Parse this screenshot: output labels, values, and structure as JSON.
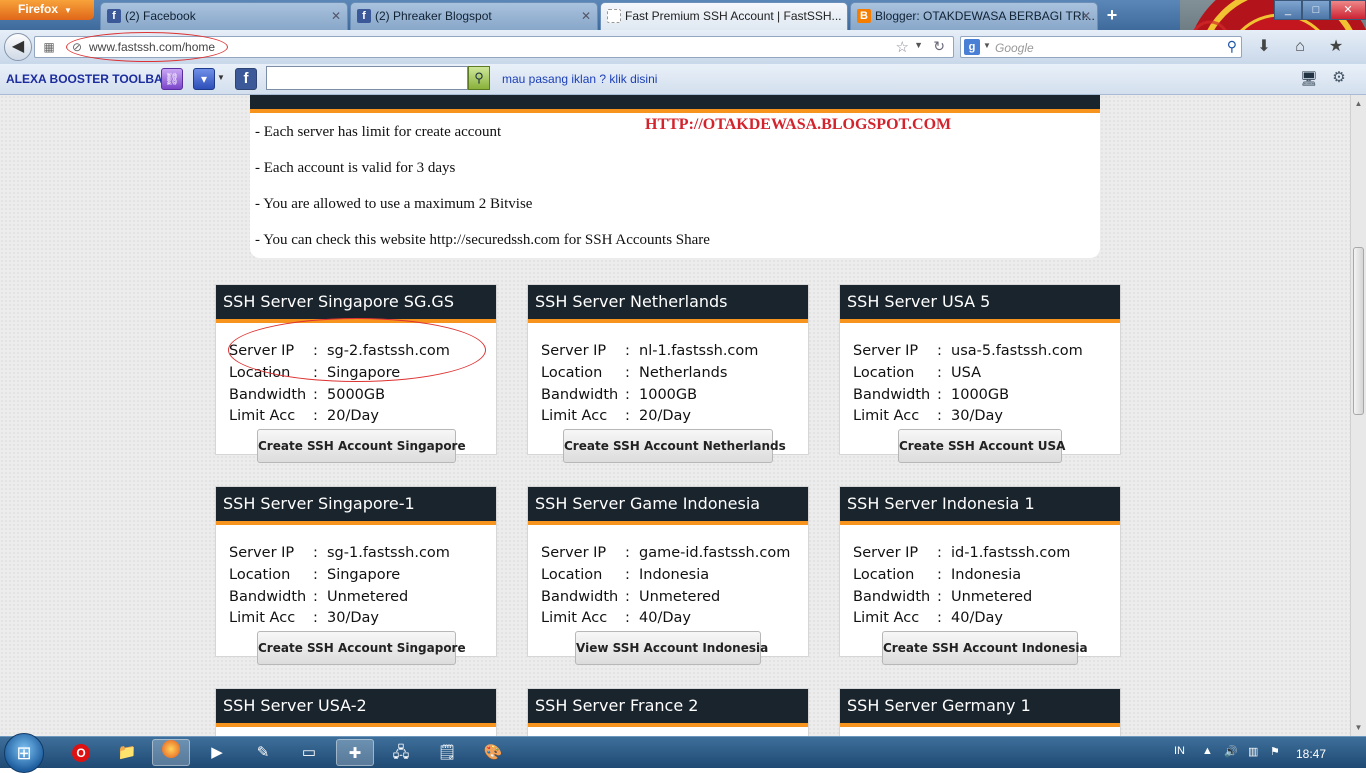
{
  "browser": {
    "menu_label": "Firefox",
    "tabs": [
      {
        "label": "(2) Facebook",
        "icon": "facebook-icon",
        "color": "#3b5998",
        "glyph": "f"
      },
      {
        "label": "(2) Phreaker Blogspot",
        "icon": "facebook-icon",
        "color": "#3b5998",
        "glyph": "f"
      },
      {
        "label": "Fast Premium SSH Account | FastSSH...",
        "icon": "page-icon",
        "color": "#cccccc",
        "glyph": ""
      },
      {
        "label": "Blogger: OTAKDEWASA BERBAGI TRI...",
        "icon": "blogger-icon",
        "color": "#f57d00",
        "glyph": "B"
      }
    ],
    "new_tab": "+",
    "url": "www.fastssh.com/home",
    "search_placeholder": "Google",
    "window_controls": [
      "_",
      "□",
      "✕"
    ]
  },
  "toolbar": {
    "title": "ALEXA BOOSTER TOOLBAR",
    "link_text": "mau pasang iklan ? klik disini"
  },
  "notice": {
    "lines": [
      "- Each server has limit for create account",
      "- Each account is valid for 3 days",
      "- You are allowed to use a maximum 2 Bitvise",
      "- You can check this website http://securedssh.com for SSH Accounts Share"
    ],
    "watermark": "HTTP://OTAKDEWASA.BLOGSPOT.COM"
  },
  "labels": {
    "server_ip": "Server IP",
    "location": "Location",
    "bandwidth": "Bandwidth",
    "limit": "Limit Acc",
    "sep": ":"
  },
  "servers": [
    {
      "title": "SSH Server Singapore SG.GS",
      "ip": "sg-2.fastssh.com",
      "location": "Singapore",
      "bandwidth": "5000GB",
      "limit": "20/Day",
      "button": "Create SSH Account Singapore"
    },
    {
      "title": "SSH Server Netherlands",
      "ip": "nl-1.fastssh.com",
      "location": "Netherlands",
      "bandwidth": "1000GB",
      "limit": "20/Day",
      "button": "Create SSH Account Netherlands"
    },
    {
      "title": "SSH Server USA 5",
      "ip": "usa-5.fastssh.com",
      "location": "USA",
      "bandwidth": "1000GB",
      "limit": "30/Day",
      "button": "Create SSH Account USA"
    },
    {
      "title": "SSH Server Singapore-1",
      "ip": "sg-1.fastssh.com",
      "location": "Singapore",
      "bandwidth": "Unmetered",
      "limit": "30/Day",
      "button": "Create SSH Account Singapore"
    },
    {
      "title": "SSH Server Game Indonesia",
      "ip": "game-id.fastssh.com",
      "location": "Indonesia",
      "bandwidth": "Unmetered",
      "limit": "40/Day",
      "button": "View SSH Account Indonesia"
    },
    {
      "title": "SSH Server Indonesia 1",
      "ip": "id-1.fastssh.com",
      "location": "Indonesia",
      "bandwidth": "Unmetered",
      "limit": "40/Day",
      "button": "Create SSH Account Indonesia"
    },
    {
      "title": "SSH Server USA-2"
    },
    {
      "title": "SSH Server France 2"
    },
    {
      "title": "SSH Server Germany 1"
    }
  ],
  "taskbar": {
    "language": "IN",
    "clock": "18:47"
  },
  "colors": {
    "header_dark": "#1a242c",
    "accent_orange": "#f7941d",
    "watermark_red": "#d3232c",
    "annotation_red": "#dd3333"
  }
}
